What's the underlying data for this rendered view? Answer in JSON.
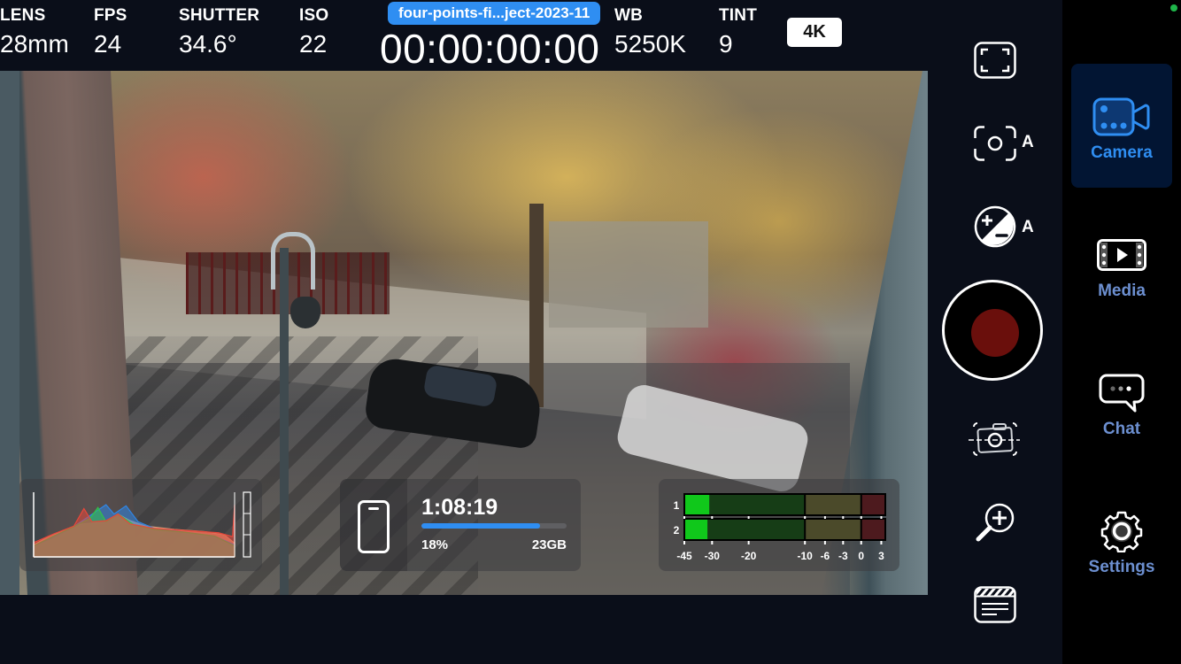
{
  "top_bar": {
    "stats": [
      {
        "label": "LENS",
        "value": "28mm"
      },
      {
        "label": "FPS",
        "value": "24"
      },
      {
        "label": "SHUTTER",
        "value": "34.6°"
      },
      {
        "label": "ISO",
        "value": "22"
      },
      {
        "label": "WB",
        "value": "5250K"
      },
      {
        "label": "TINT",
        "value": "9"
      }
    ],
    "clip_name": "four-points-fi...ject-2023-11",
    "timecode": "00:00:00:00",
    "resolution": "4K"
  },
  "viewfinder": {
    "histogram": {
      "channels": [
        "red",
        "green",
        "blue",
        "luma"
      ],
      "colors": {
        "red": "#e8473a",
        "green": "#31c24a",
        "blue": "#2f86e6",
        "luma": "#d9a07a"
      }
    },
    "storage": {
      "remaining_time": "1:08:19",
      "used_percent_label": "18%",
      "fill_fraction": 0.82,
      "capacity_label": "23GB",
      "icon": "phone-storage-icon"
    },
    "audio_meter": {
      "channels": [
        {
          "label": "1",
          "level_db": -32
        },
        {
          "label": "2",
          "level_db": -33
        }
      ],
      "scale_labels": [
        "-45",
        "-30",
        "-20",
        "-10",
        "-6",
        "-3",
        "0",
        "3"
      ],
      "colors": {
        "active": "#10c81b",
        "green_zone": "#163d16",
        "yellow_zone": "#4b4a2a",
        "red_zone": "#4d1a1e"
      }
    }
  },
  "controls": {
    "frame_guides": "frame-guides-icon",
    "auto_focus": {
      "icon": "focus-icon",
      "mode": "A"
    },
    "exposure": {
      "icon": "exposure-comp-icon",
      "mode": "A"
    },
    "record": {
      "icon": "record-icon",
      "color": "#6a0f0c"
    },
    "photo": "photo-capture-icon",
    "zoom": "zoom-in-icon",
    "slate": "clapperboard-icon"
  },
  "nav": {
    "status_color": "#1fb64a",
    "items": [
      {
        "label": "Camera",
        "icon": "video-camera-icon",
        "active": true
      },
      {
        "label": "Media",
        "icon": "media-film-icon",
        "active": false
      },
      {
        "label": "Chat",
        "icon": "chat-bubble-icon",
        "active": false
      },
      {
        "label": "Settings",
        "icon": "gear-icon",
        "active": false
      }
    ]
  }
}
